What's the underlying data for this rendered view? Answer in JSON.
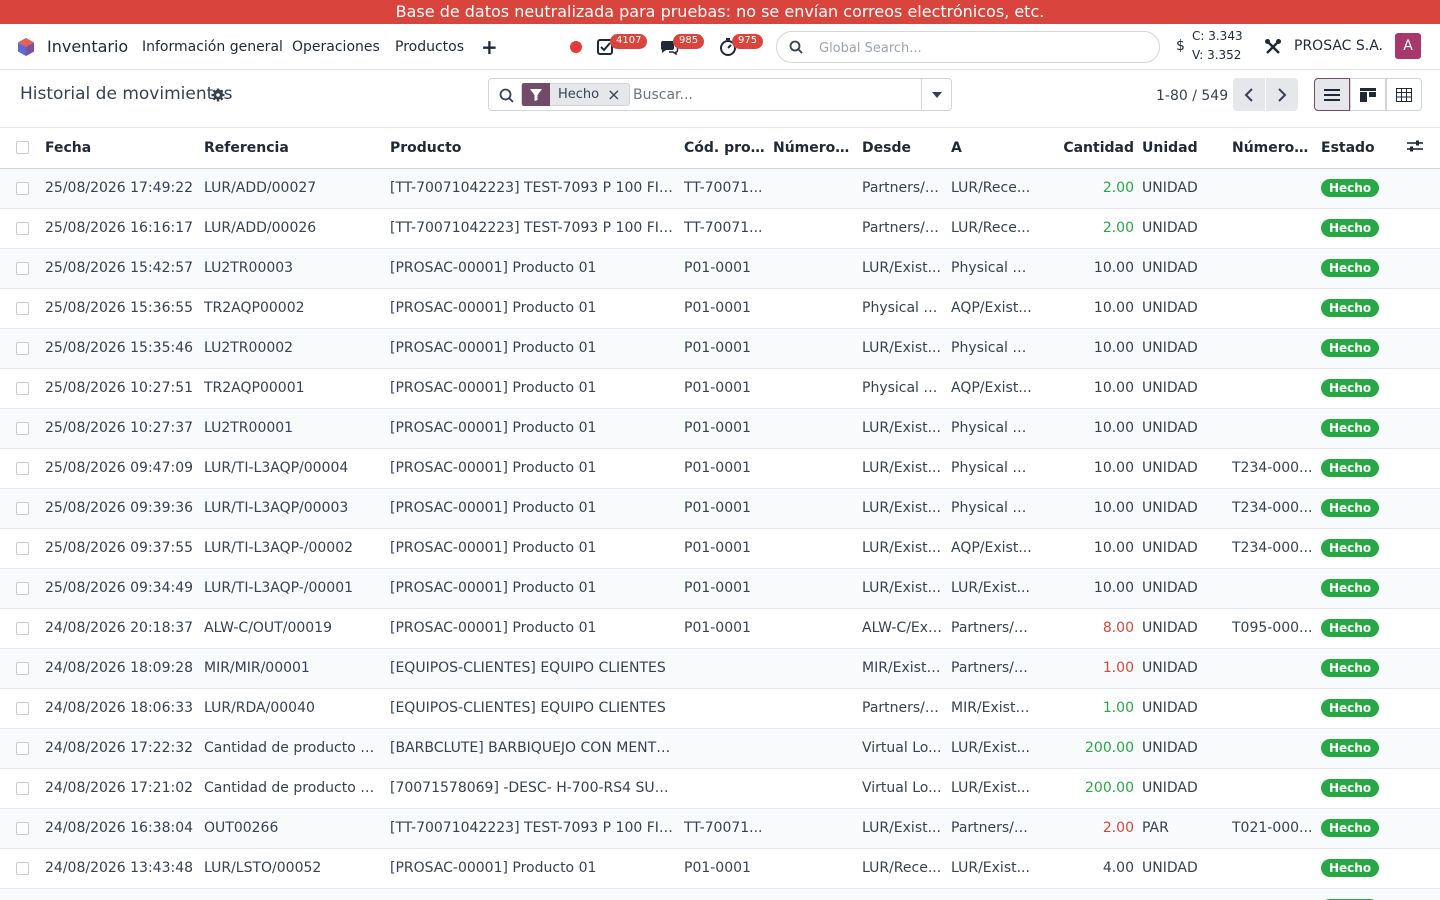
{
  "banner": "Base de datos neutralizada para pruebas: no se envían correos electrónicos, etc.",
  "navbar": {
    "app_name": "Inventario",
    "menu": [
      "Información general",
      "Operaciones",
      "Productos"
    ],
    "badges": {
      "activities": "4107",
      "messages": "985",
      "timers": "975"
    },
    "global_search_placeholder": "Global Search...",
    "currency_symbol": "$",
    "rate_c": "C: 3.343",
    "rate_v": "V: 3.352",
    "company": "PROSAC S.A.",
    "avatar_letter": "A"
  },
  "control": {
    "title": "Historial de movimientos",
    "facet_label": "Hecho",
    "search_placeholder": "Buscar...",
    "pager": "1-80 / 549"
  },
  "colors": {
    "brand": "#714b67",
    "banner": "#d9453d",
    "success": "#28a745",
    "danger": "#d9453d"
  },
  "table": {
    "columns": [
      "Fecha",
      "Referencia",
      "Producto",
      "Cód. prov...",
      "Número d...",
      "Desde",
      "A",
      "Cantidad",
      "Unidad",
      "Número d...",
      "Estado"
    ],
    "rows": [
      {
        "fecha": "25/08/2026 17:49:22",
        "ref": "LUR/ADD/00027",
        "producto": "[TT-70071042223] TEST-7093 P 100 FIL...",
        "cod": "TT-70071...",
        "num1": "",
        "desde": "Partners/C...",
        "a": "LUR/Rece...",
        "cant": "2.00",
        "sign": "pos",
        "unidad": "UNIDAD",
        "num2": "",
        "estado": "Hecho"
      },
      {
        "fecha": "25/08/2026 16:16:17",
        "ref": "LUR/ADD/00026",
        "producto": "[TT-70071042223] TEST-7093 P 100 FIL...",
        "cod": "TT-70071...",
        "num1": "",
        "desde": "Partners/C...",
        "a": "LUR/Rece...",
        "cant": "2.00",
        "sign": "pos",
        "unidad": "UNIDAD",
        "num2": "",
        "estado": "Hecho"
      },
      {
        "fecha": "25/08/2026 15:42:57",
        "ref": "LU2TR00003",
        "producto": "[PROSAC-00001] Producto 01",
        "cod": "P01-0001",
        "num1": "",
        "desde": "LUR/Exist...",
        "a": "Physical L...",
        "cant": "10.00",
        "sign": "",
        "unidad": "UNIDAD",
        "num2": "",
        "estado": "Hecho"
      },
      {
        "fecha": "25/08/2026 15:36:55",
        "ref": "TR2AQP00002",
        "producto": "[PROSAC-00001] Producto 01",
        "cod": "P01-0001",
        "num1": "",
        "desde": "Physical L...",
        "a": "AQP/Exist...",
        "cant": "10.00",
        "sign": "",
        "unidad": "UNIDAD",
        "num2": "",
        "estado": "Hecho"
      },
      {
        "fecha": "25/08/2026 15:35:46",
        "ref": "LU2TR00002",
        "producto": "[PROSAC-00001] Producto 01",
        "cod": "P01-0001",
        "num1": "",
        "desde": "LUR/Exist...",
        "a": "Physical L...",
        "cant": "10.00",
        "sign": "",
        "unidad": "UNIDAD",
        "num2": "",
        "estado": "Hecho"
      },
      {
        "fecha": "25/08/2026 10:27:51",
        "ref": "TR2AQP00001",
        "producto": "[PROSAC-00001] Producto 01",
        "cod": "P01-0001",
        "num1": "",
        "desde": "Physical L...",
        "a": "AQP/Exist...",
        "cant": "10.00",
        "sign": "",
        "unidad": "UNIDAD",
        "num2": "",
        "estado": "Hecho"
      },
      {
        "fecha": "25/08/2026 10:27:37",
        "ref": "LU2TR00001",
        "producto": "[PROSAC-00001] Producto 01",
        "cod": "P01-0001",
        "num1": "",
        "desde": "LUR/Exist...",
        "a": "Physical L...",
        "cant": "10.00",
        "sign": "",
        "unidad": "UNIDAD",
        "num2": "",
        "estado": "Hecho"
      },
      {
        "fecha": "25/08/2026 09:47:09",
        "ref": "LUR/TI-L3AQP/00004",
        "producto": "[PROSAC-00001] Producto 01",
        "cod": "P01-0001",
        "num1": "",
        "desde": "LUR/Exist...",
        "a": "Physical L...",
        "cant": "10.00",
        "sign": "",
        "unidad": "UNIDAD",
        "num2": "T234-000...",
        "estado": "Hecho"
      },
      {
        "fecha": "25/08/2026 09:39:36",
        "ref": "LUR/TI-L3AQP/00003",
        "producto": "[PROSAC-00001] Producto 01",
        "cod": "P01-0001",
        "num1": "",
        "desde": "LUR/Exist...",
        "a": "Physical L...",
        "cant": "10.00",
        "sign": "",
        "unidad": "UNIDAD",
        "num2": "T234-000...",
        "estado": "Hecho"
      },
      {
        "fecha": "25/08/2026 09:37:55",
        "ref": "LUR/TI-L3AQP-/00002",
        "producto": "[PROSAC-00001] Producto 01",
        "cod": "P01-0001",
        "num1": "",
        "desde": "LUR/Exist...",
        "a": "AQP/Exist...",
        "cant": "10.00",
        "sign": "",
        "unidad": "UNIDAD",
        "num2": "T234-000...",
        "estado": "Hecho"
      },
      {
        "fecha": "25/08/2026 09:34:49",
        "ref": "LUR/TI-L3AQP-/00001",
        "producto": "[PROSAC-00001] Producto 01",
        "cod": "P01-0001",
        "num1": "",
        "desde": "LUR/Exist...",
        "a": "LUR/Exist...",
        "cant": "10.00",
        "sign": "",
        "unidad": "UNIDAD",
        "num2": "",
        "estado": "Hecho"
      },
      {
        "fecha": "24/08/2026 20:18:37",
        "ref": "ALW-C/OUT/00019",
        "producto": "[PROSAC-00001] Producto 01",
        "cod": "P01-0001",
        "num1": "",
        "desde": "ALW-C/Exi...",
        "a": "Partners/C...",
        "cant": "8.00",
        "sign": "neg",
        "unidad": "UNIDAD",
        "num2": "T095-000...",
        "estado": "Hecho"
      },
      {
        "fecha": "24/08/2026 18:09:28",
        "ref": "MIR/MIR/00001",
        "producto": "[EQUIPOS-CLIENTES] EQUIPO CLIENTES",
        "cod": "",
        "num1": "",
        "desde": "MIR/Existe...",
        "a": "Partners/C...",
        "cant": "1.00",
        "sign": "neg",
        "unidad": "UNIDAD",
        "num2": "",
        "estado": "Hecho"
      },
      {
        "fecha": "24/08/2026 18:06:33",
        "ref": "LUR/RDA/00040",
        "producto": "[EQUIPOS-CLIENTES] EQUIPO CLIENTES",
        "cod": "",
        "num1": "",
        "desde": "Partners/V...",
        "a": "MIR/Existe...",
        "cant": "1.00",
        "sign": "pos",
        "unidad": "UNIDAD",
        "num2": "",
        "estado": "Hecho"
      },
      {
        "fecha": "24/08/2026 17:22:32",
        "ref": "Cantidad de producto act...",
        "producto": "[BARBCLUTE] BARBIQUEJO CON MENTO...",
        "cod": "",
        "num1": "",
        "desde": "Virtual Lo...",
        "a": "LUR/Exist...",
        "cant": "200.00",
        "sign": "pos",
        "unidad": "UNIDAD",
        "num2": "",
        "estado": "Hecho"
      },
      {
        "fecha": "24/08/2026 17:21:02",
        "ref": "Cantidad de producto act...",
        "producto": "[70071578069] -DESC- H-700-RS4 SUS...",
        "cod": "",
        "num1": "",
        "desde": "Virtual Lo...",
        "a": "LUR/Exist...",
        "cant": "200.00",
        "sign": "pos",
        "unidad": "UNIDAD",
        "num2": "",
        "estado": "Hecho"
      },
      {
        "fecha": "24/08/2026 16:38:04",
        "ref": "OUT00266",
        "producto": "[TT-70071042223] TEST-7093 P 100 FIL...",
        "cod": "TT-70071...",
        "num1": "",
        "desde": "LUR/Exist...",
        "a": "Partners/C...",
        "cant": "2.00",
        "sign": "neg",
        "unidad": "PAR",
        "num2": "T021-000...",
        "estado": "Hecho"
      },
      {
        "fecha": "24/08/2026 13:43:48",
        "ref": "LUR/LSTO/00052",
        "producto": "[PROSAC-00001] Producto 01",
        "cod": "P01-0001",
        "num1": "",
        "desde": "LUR/Rece...",
        "a": "LUR/Exist...",
        "cant": "4.00",
        "sign": "",
        "unidad": "UNIDAD",
        "num2": "",
        "estado": "Hecho"
      },
      {
        "fecha": "",
        "ref": "",
        "producto": "",
        "cod": "",
        "num1": "",
        "desde": "",
        "a": "",
        "cant": "",
        "sign": "",
        "unidad": "",
        "num2": "",
        "estado": "Hecho"
      }
    ]
  }
}
